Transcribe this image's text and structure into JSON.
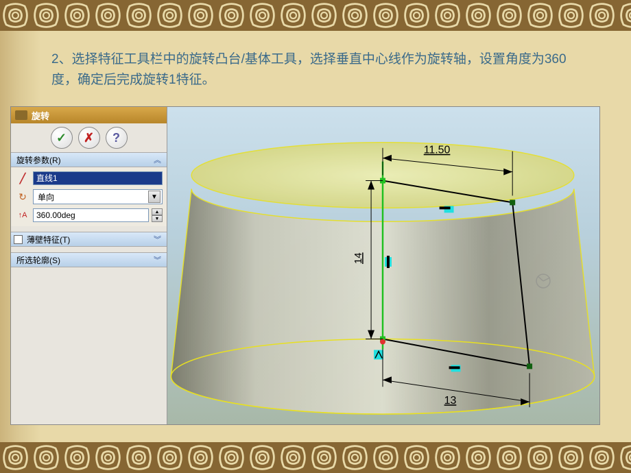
{
  "ornament_pattern": "celtic-knot",
  "instruction_text": "2、选择特征工具栏中的旋转凸台/基体工具，选择垂直中心线作为旋转轴，设置角度为360度，确定后完成旋转1特征。",
  "panel": {
    "title": "旋转",
    "ok_symbol": "✓",
    "cancel_symbol": "✗",
    "help_symbol": "?",
    "sections": {
      "params": {
        "header": "旋转参数(R)",
        "chevron": "︽",
        "axis_value": "直线1",
        "direction_value": "单向",
        "angle_value": "360.00deg"
      },
      "thin": {
        "header_label": "薄壁特征(T)",
        "chevron": "︾",
        "checked": false
      },
      "profile": {
        "header": "所选轮廓(S)",
        "chevron": "︾"
      }
    }
  },
  "viewport": {
    "dimensions": {
      "top_radius": "11.50",
      "height": "14",
      "bottom_radius": "13"
    },
    "colors": {
      "top_face": "#e8e090",
      "body_light": "#d8d8c8",
      "body_dark": "#888878",
      "outline": "#e8e020",
      "sketch_line": "#000000",
      "axis_line": "#20c020",
      "constraint": "#20e0e0"
    }
  }
}
